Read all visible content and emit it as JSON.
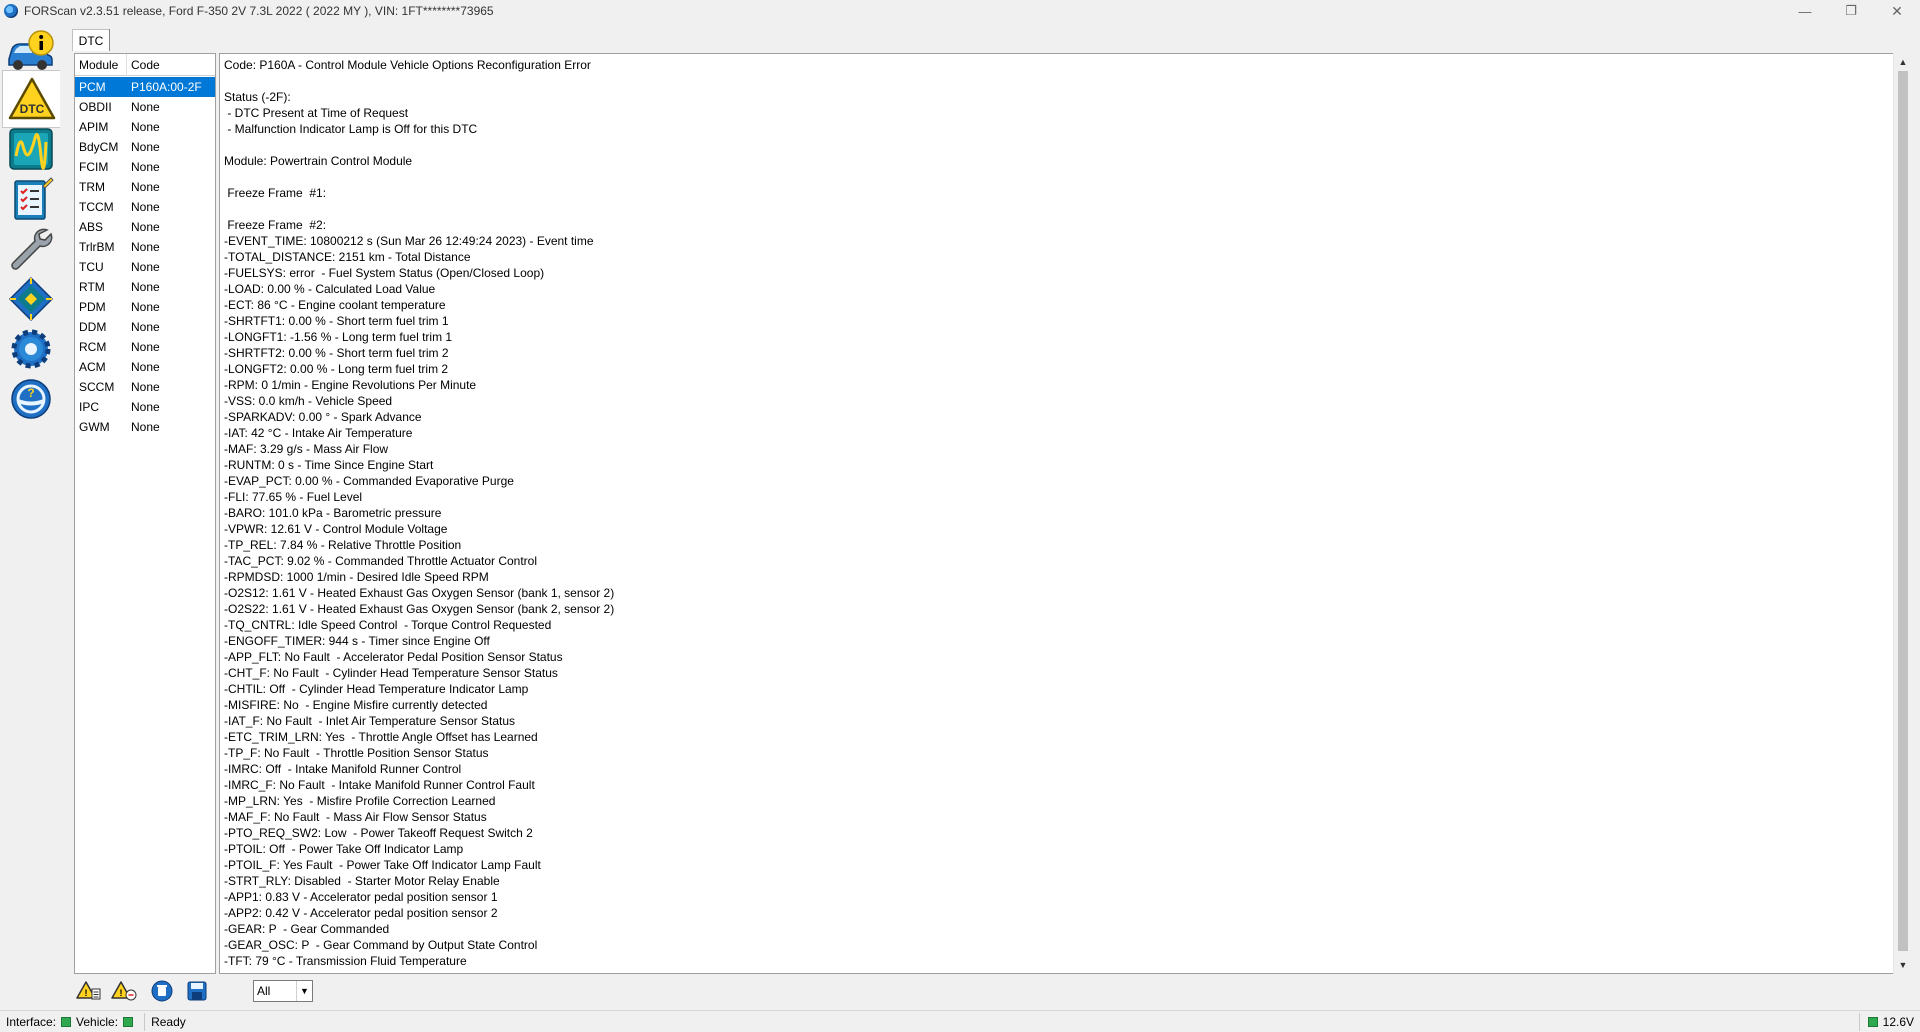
{
  "window": {
    "title": "FORScan v2.3.51 release, Ford F-350 2V 7.3L 2022 ( 2022 MY ), VIN: 1FT********73965",
    "minimize_glyph": "—",
    "maximize_glyph": "❐",
    "close_glyph": "✕"
  },
  "tabs": [
    {
      "label": "DTC"
    }
  ],
  "module_list": {
    "headers": {
      "module": "Module",
      "code": "Code"
    },
    "rows": [
      {
        "module": "PCM",
        "code": "P160A:00-2F",
        "selected": true
      },
      {
        "module": "OBDII",
        "code": "None"
      },
      {
        "module": "APIM",
        "code": "None"
      },
      {
        "module": "BdyCM",
        "code": "None"
      },
      {
        "module": "FCIM",
        "code": "None"
      },
      {
        "module": "TRM",
        "code": "None"
      },
      {
        "module": "TCCM",
        "code": "None"
      },
      {
        "module": "ABS",
        "code": "None"
      },
      {
        "module": "TrlrBM",
        "code": "None"
      },
      {
        "module": "TCU",
        "code": "None"
      },
      {
        "module": "RTM",
        "code": "None"
      },
      {
        "module": "PDM",
        "code": "None"
      },
      {
        "module": "DDM",
        "code": "None"
      },
      {
        "module": "RCM",
        "code": "None"
      },
      {
        "module": "ACM",
        "code": "None"
      },
      {
        "module": "SCCM",
        "code": "None"
      },
      {
        "module": "IPC",
        "code": "None"
      },
      {
        "module": "GWM",
        "code": "None"
      }
    ]
  },
  "details": {
    "lines": [
      "Code: P160A - Control Module Vehicle Options Reconfiguration Error",
      "",
      "Status (-2F):",
      " - DTC Present at Time of Request",
      " - Malfunction Indicator Lamp is Off for this DTC",
      "",
      "Module: Powertrain Control Module",
      "",
      " Freeze Frame  #1:",
      "",
      " Freeze Frame  #2:",
      "-EVENT_TIME: 10800212 s (Sun Mar 26 12:49:24 2023) - Event time",
      "-TOTAL_DISTANCE: 2151 km - Total Distance",
      "-FUELSYS: error  - Fuel System Status (Open/Closed Loop)",
      "-LOAD: 0.00 % - Calculated Load Value",
      "-ECT: 86 °C - Engine coolant temperature",
      "-SHRTFT1: 0.00 % - Short term fuel trim 1",
      "-LONGFT1: -1.56 % - Long term fuel trim 1",
      "-SHRTFT2: 0.00 % - Short term fuel trim 2",
      "-LONGFT2: 0.00 % - Long term fuel trim 2",
      "-RPM: 0 1/min - Engine Revolutions Per Minute",
      "-VSS: 0.0 km/h - Vehicle Speed",
      "-SPARKADV: 0.00 ° - Spark Advance",
      "-IAT: 42 °C - Intake Air Temperature",
      "-MAF: 3.29 g/s - Mass Air Flow",
      "-RUNTM: 0 s - Time Since Engine Start",
      "-EVAP_PCT: 0.00 % - Commanded Evaporative Purge",
      "-FLI: 77.65 % - Fuel Level",
      "-BARO: 101.0 kPa - Barometric pressure",
      "-VPWR: 12.61 V - Control Module Voltage",
      "-TP_REL: 7.84 % - Relative Throttle Position",
      "-TAC_PCT: 9.02 % - Commanded Throttle Actuator Control",
      "-RPMDSD: 1000 1/min - Desired Idle Speed RPM",
      "-O2S12: 1.61 V - Heated Exhaust Gas Oxygen Sensor (bank 1, sensor 2)",
      "-O2S22: 1.61 V - Heated Exhaust Gas Oxygen Sensor (bank 2, sensor 2)",
      "-TQ_CNTRL: Idle Speed Control  - Torque Control Requested",
      "-ENGOFF_TIMER: 944 s - Timer since Engine Off",
      "-APP_FLT: No Fault  - Accelerator Pedal Position Sensor Status",
      "-CHT_F: No Fault  - Cylinder Head Temperature Sensor Status",
      "-CHTIL: Off  - Cylinder Head Temperature Indicator Lamp",
      "-MISFIRE: No  - Engine Misfire currently detected",
      "-IAT_F: No Fault  - Inlet Air Temperature Sensor Status",
      "-ETC_TRIM_LRN: Yes  - Throttle Angle Offset has Learned",
      "-TP_F: No Fault  - Throttle Position Sensor Status",
      "-IMRC: Off  - Intake Manifold Runner Control",
      "-IMRC_F: No Fault  - Intake Manifold Runner Control Fault",
      "-MP_LRN: Yes  - Misfire Profile Correction Learned",
      "-MAF_F: No Fault  - Mass Air Flow Sensor Status",
      "-PTO_REQ_SW2: Low  - Power Takeoff Request Switch 2",
      "-PTOIL: Off  - Power Take Off Indicator Lamp",
      "-PTOIL_F: Yes Fault  - Power Take Off Indicator Lamp Fault",
      "-STRT_RLY: Disabled  - Starter Motor Relay Enable",
      "-APP1: 0.83 V - Accelerator pedal position sensor 1",
      "-APP2: 0.42 V - Accelerator pedal position sensor 2",
      "-GEAR: P  - Gear Commanded",
      "-GEAR_OSC: P  - Gear Command by Output State Control",
      "-TFT: 79 °C - Transmission Fluid Temperature"
    ]
  },
  "scrollbar": {
    "up_glyph": "▲",
    "down_glyph": "▼"
  },
  "bottom_toolbar": {
    "filter": {
      "selected": "All",
      "arrow_glyph": "▼"
    }
  },
  "statusbar": {
    "interface_label": "Interface:",
    "vehicle_label": "Vehicle:",
    "status_text": "Ready",
    "voltage": "12.6V"
  },
  "colors": {
    "selection": "#0078d7",
    "led_ok": "#2fa84f",
    "accent_yellow": "#ffd21f",
    "icon_blue": "#1f6fc4",
    "icon_teal": "#0c7b8c"
  },
  "icons": {
    "left_toolbar": [
      "vehicle-info-icon",
      "dtc-warning-icon",
      "oscilloscope-icon",
      "checklist-icon",
      "wrench-icon",
      "module-config-icon",
      "settings-gear-icon",
      "help-steering-icon"
    ],
    "bottom_toolbar": [
      "read-dtc-icon",
      "clear-dtc-icon",
      "delete-icon",
      "save-icon"
    ]
  }
}
